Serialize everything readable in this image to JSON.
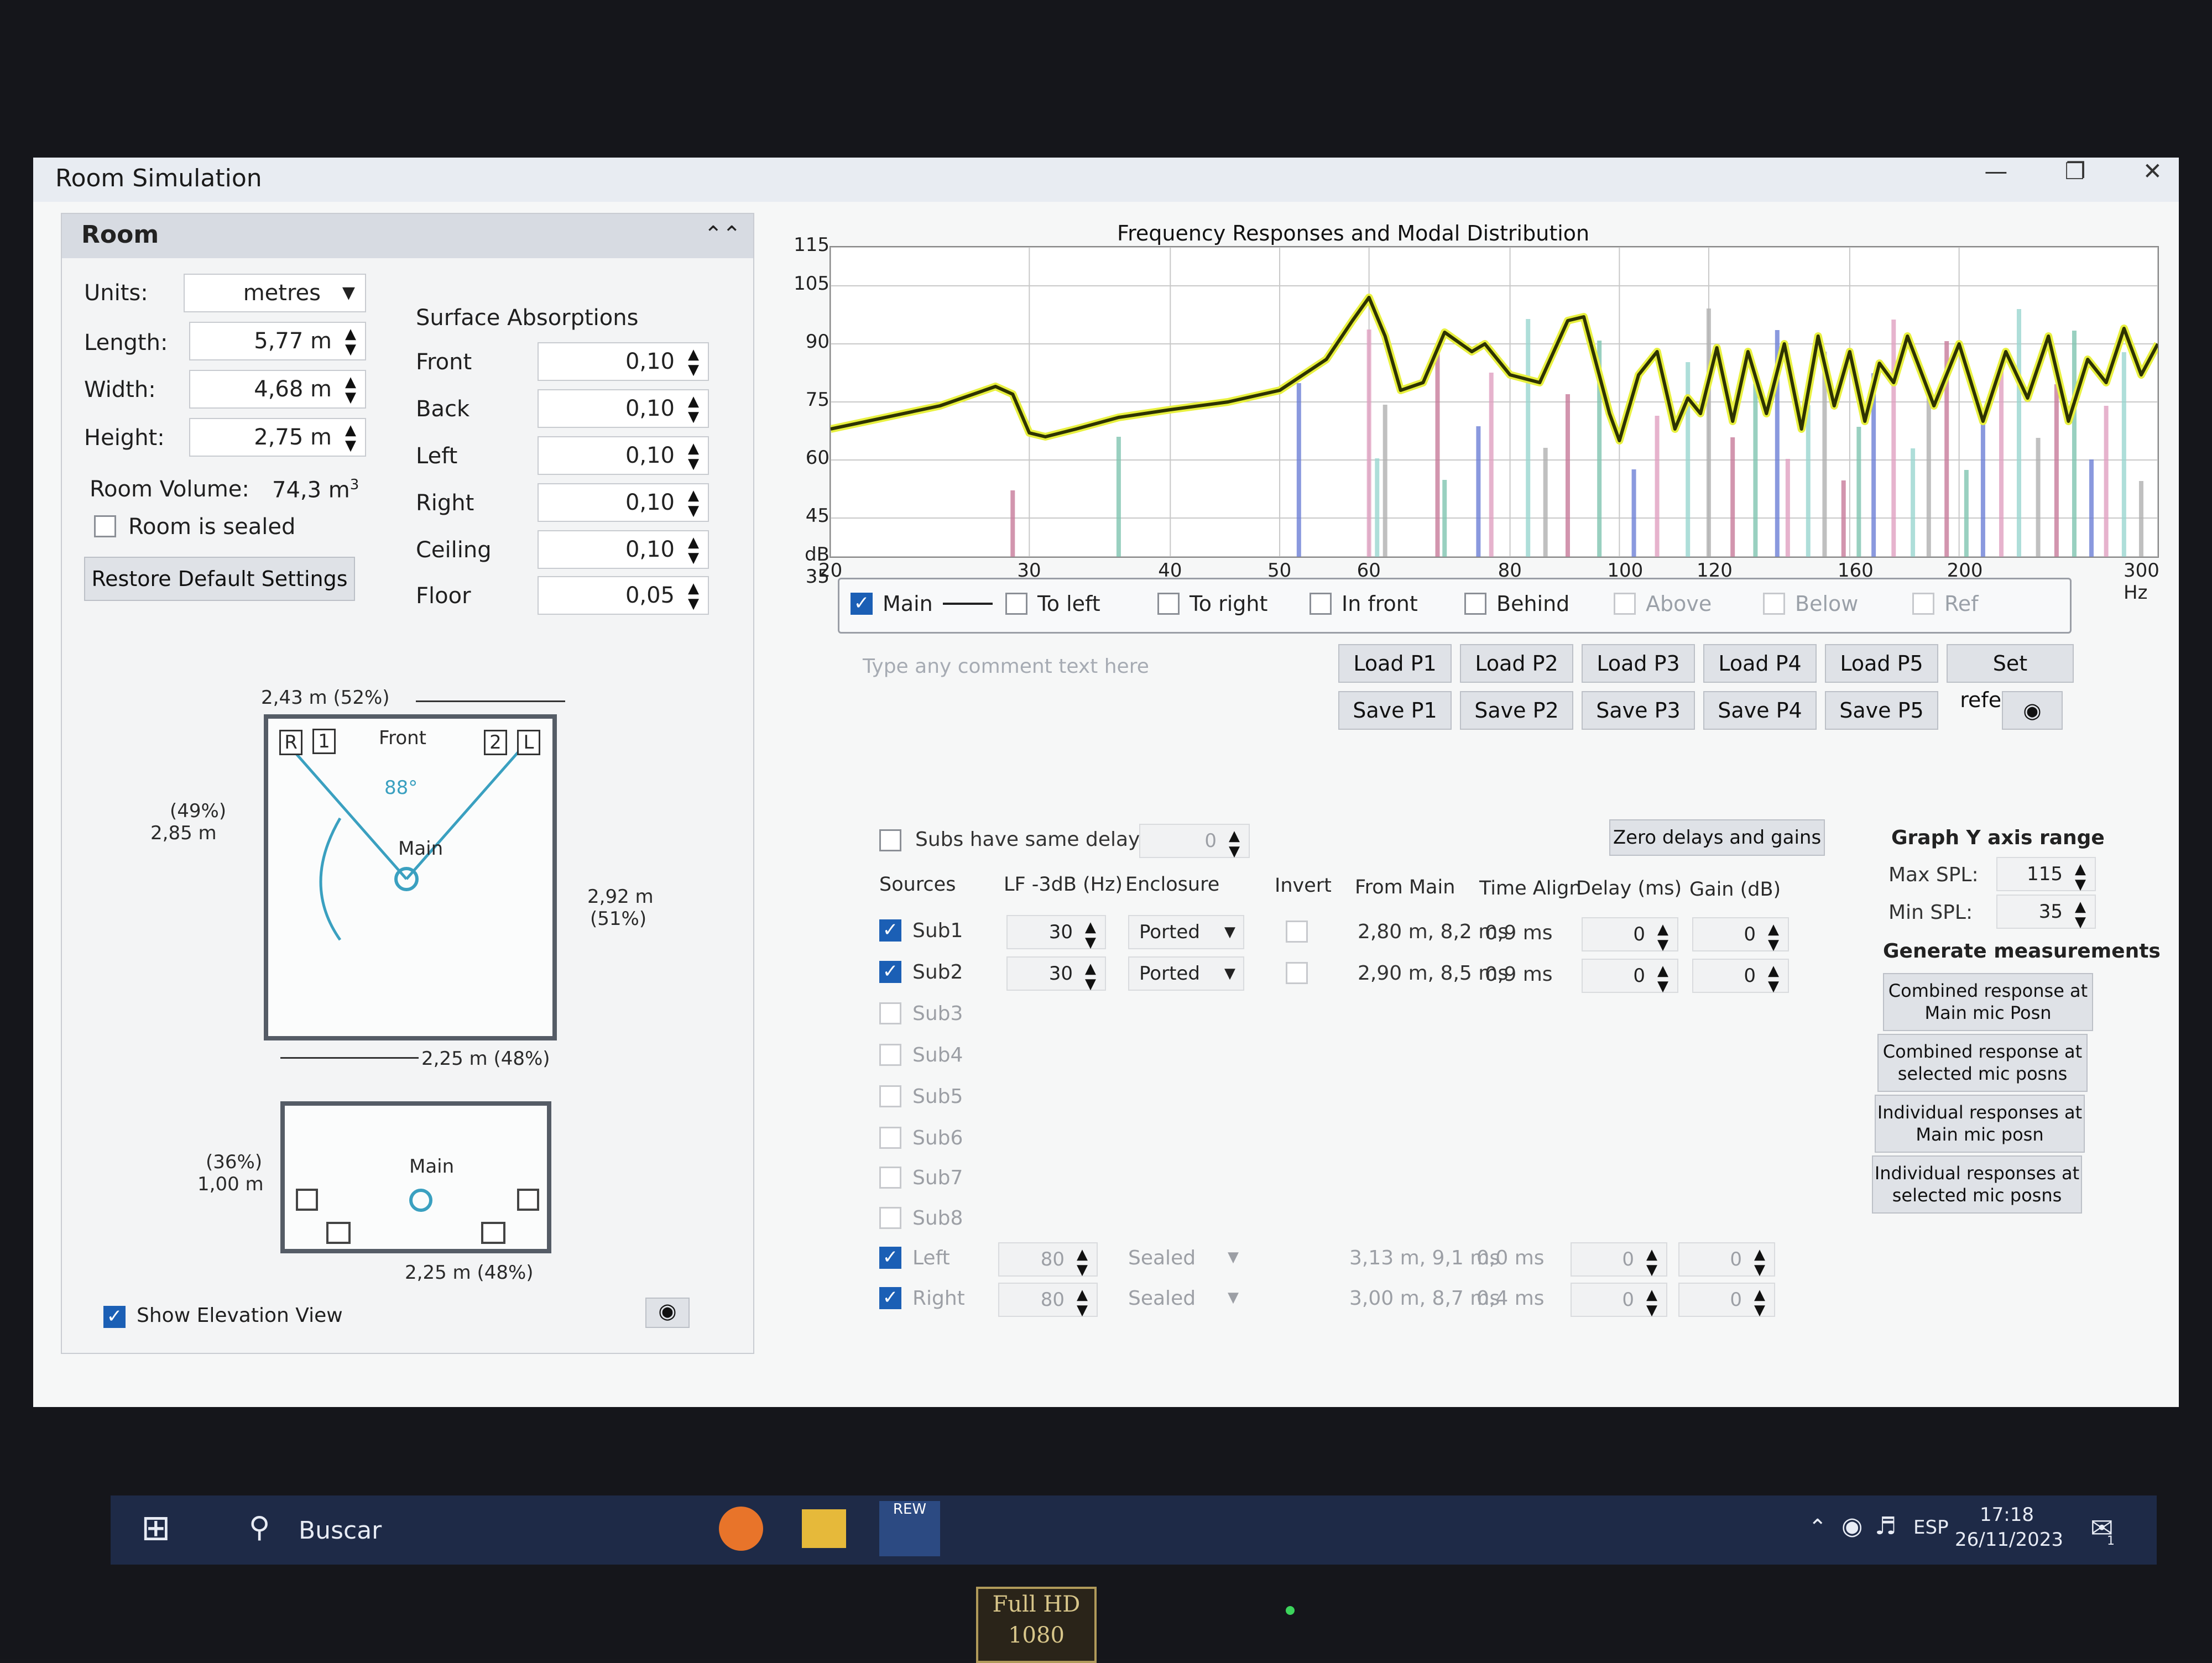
{
  "window": {
    "title": "Room Simulation",
    "controls": [
      "—",
      "❐",
      "✕"
    ]
  },
  "room": {
    "header": "Room",
    "units_label": "Units:",
    "units_value": "metres",
    "length_label": "Length:",
    "length_value": "5,77 m",
    "width_label": "Width:",
    "width_value": "4,68 m",
    "height_label": "Height:",
    "height_value": "2,75 m",
    "volume_label": "Room Volume:",
    "volume_value": "74,3 m",
    "volume_unit_sup": "3",
    "sealed_label": "Room is sealed",
    "restore_label": "Restore Default Settings",
    "absorption_title": "Surface Absorptions",
    "absorptions": [
      {
        "label": "Front",
        "value": "0,10"
      },
      {
        "label": "Back",
        "value": "0,10"
      },
      {
        "label": "Left",
        "value": "0,10"
      },
      {
        "label": "Right",
        "value": "0,10"
      },
      {
        "label": "Ceiling",
        "value": "0,10"
      },
      {
        "label": "Floor",
        "value": "0,05"
      }
    ]
  },
  "plan": {
    "top_dim": "2,43 m (52%)",
    "left_dim_pct": "(49%)",
    "left_dim": "2,85 m",
    "right_dim": "2,92 m",
    "right_dim_pct": "(51%)",
    "bottom_dim": "2,25 m (48%)",
    "front_label": "Front",
    "angle_label": "88°",
    "main_label": "Main",
    "speaker_r": "R",
    "speaker_1": "1",
    "speaker_2": "2",
    "speaker_l": "L",
    "elev_left_pct": "(36%)",
    "elev_left": "1,00 m",
    "elev_bottom": "2,25 m (48%)",
    "elev_main_label": "Main",
    "show_elevation_label": "Show Elevation View"
  },
  "graph": {
    "title": "Frequency Responses and Modal Distribution",
    "y_ticks": [
      "115",
      "105",
      "90",
      "75",
      "60",
      "45",
      "dB 35"
    ],
    "x_ticks": [
      "20",
      "30",
      "40",
      "50",
      "60",
      "80",
      "100",
      "120",
      "160",
      "200",
      "300 Hz"
    ],
    "legend": [
      {
        "label": "Main",
        "checked": true,
        "dim": false
      },
      {
        "label": "To left",
        "checked": false,
        "dim": false
      },
      {
        "label": "To right",
        "checked": false,
        "dim": false
      },
      {
        "label": "In front",
        "checked": false,
        "dim": false
      },
      {
        "label": "Behind",
        "checked": false,
        "dim": false
      },
      {
        "label": "Above",
        "checked": false,
        "dim": true
      },
      {
        "label": "Below",
        "checked": false,
        "dim": true
      },
      {
        "label": "Ref",
        "checked": false,
        "dim": true
      }
    ],
    "comment_placeholder": "Type any comment text here",
    "load_buttons": [
      "Load P1",
      "Load P2",
      "Load P3",
      "Load P4",
      "Load P5"
    ],
    "save_buttons": [
      "Save P1",
      "Save P2",
      "Save P3",
      "Save P4",
      "Save P5"
    ],
    "set_reference": "Set reference",
    "colors": {
      "curve": "#2e3300",
      "curve_glow": "#e8f040",
      "modal_bars": [
        "#c77a9a",
        "#7fc4b0",
        "#6d7fd6",
        "#e0a0c0",
        "#9ad6d0",
        "#b0b0b0"
      ]
    }
  },
  "chart_data": {
    "type": "line",
    "title": "Frequency Responses and Modal Distribution",
    "xlabel": "Hz",
    "ylabel": "dB",
    "x_scale": "log",
    "xlim": [
      20,
      300
    ],
    "ylim": [
      35,
      115
    ],
    "x_ticks": [
      20,
      30,
      40,
      50,
      60,
      80,
      100,
      120,
      160,
      200,
      300
    ],
    "y_ticks": [
      35,
      45,
      60,
      75,
      90,
      105,
      115
    ],
    "grid": true,
    "series": [
      {
        "name": "Main",
        "x": [
          20,
          25,
          28,
          29,
          30,
          31,
          33,
          36,
          40,
          45,
          50,
          55,
          58,
          60,
          62,
          64,
          67,
          70,
          74,
          76,
          80,
          85,
          90,
          93,
          98,
          100,
          104,
          108,
          112,
          115,
          118,
          122,
          126,
          130,
          135,
          140,
          145,
          150,
          155,
          160,
          165,
          170,
          175,
          180,
          190,
          200,
          210,
          220,
          230,
          240,
          250,
          260,
          270,
          280,
          290,
          300
        ],
        "y": [
          68,
          74,
          79,
          77,
          67,
          66,
          68,
          71,
          73,
          75,
          78,
          86,
          96,
          102,
          92,
          78,
          80,
          93,
          88,
          90,
          82,
          80,
          96,
          97,
          72,
          65,
          82,
          88,
          68,
          76,
          72,
          89,
          70,
          88,
          72,
          90,
          68,
          92,
          74,
          88,
          70,
          85,
          80,
          92,
          74,
          90,
          70,
          88,
          76,
          92,
          70,
          86,
          80,
          94,
          82,
          90
        ]
      }
    ],
    "modal_bars_hz": [
      29,
      36,
      52,
      60,
      61,
      62,
      69,
      70,
      75,
      77,
      83,
      86,
      90,
      96,
      103,
      108,
      115,
      120,
      126,
      132,
      138,
      141,
      147,
      152,
      158,
      163,
      168,
      175,
      182,
      188,
      195,
      203,
      210,
      218,
      226,
      235,
      244,
      253,
      262,
      270,
      280,
      290
    ]
  },
  "sources": {
    "same_delay_label": "Subs have same delay",
    "same_delay_value": "0",
    "zero_button": "Zero delays and gains",
    "headers": [
      "Sources",
      "LF -3dB (Hz)",
      "Enclosure",
      "Invert",
      "From Main",
      "Time Align",
      "Delay (ms)",
      "Gain (dB)"
    ],
    "rows": [
      {
        "name": "Sub1",
        "checked": true,
        "lf": "30",
        "enc": "Ported",
        "from": "2,80 m, 8,2 ms",
        "align": "0,9 ms",
        "delay": "0",
        "gain": "0"
      },
      {
        "name": "Sub2",
        "checked": true,
        "lf": "30",
        "enc": "Ported",
        "from": "2,90 m, 8,5 ms",
        "align": "0,9 ms",
        "delay": "0",
        "gain": "0"
      },
      {
        "name": "Sub3",
        "checked": false
      },
      {
        "name": "Sub4",
        "checked": false
      },
      {
        "name": "Sub5",
        "checked": false
      },
      {
        "name": "Sub6",
        "checked": false
      },
      {
        "name": "Sub7",
        "checked": false
      },
      {
        "name": "Sub8",
        "checked": false
      },
      {
        "name": "Left",
        "checked": true,
        "lf": "80",
        "enc": "Sealed",
        "from": "3,13 m, 9,1 ms",
        "align": "0,0 ms",
        "delay": "0",
        "gain": "0"
      },
      {
        "name": "Right",
        "checked": true,
        "lf": "80",
        "enc": "Sealed",
        "from": "3,00 m, 8,7 ms",
        "align": "0,4 ms",
        "delay": "0",
        "gain": "0"
      }
    ]
  },
  "yrange": {
    "title": "Graph Y axis range",
    "max_label": "Max SPL:",
    "max_value": "115",
    "min_label": "Min SPL:",
    "min_value": "35",
    "gen_title": "Generate measurements",
    "gen_buttons": [
      "Combined response at Main mic Posn",
      "Combined response at selected mic posns",
      "Individual responses at Main mic posn",
      "Individual responses at selected mic posns"
    ]
  },
  "taskbar": {
    "search_placeholder": "Buscar",
    "lang": "ESP",
    "time": "17:18",
    "date": "26/11/2023",
    "rew_icon_text": "REW",
    "notification_count": "1"
  },
  "bezel": {
    "badge_top": "Full HD",
    "badge_bottom": "1080"
  }
}
